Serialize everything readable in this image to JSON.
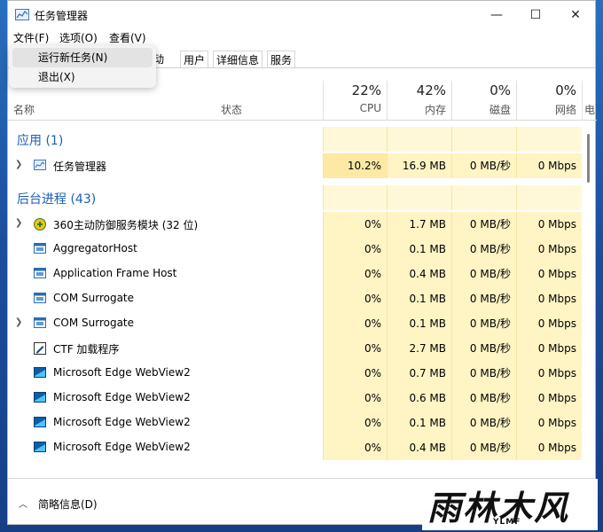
{
  "window": {
    "title": "任务管理器"
  },
  "controls": {
    "minimize": "—",
    "maximize": "☐",
    "close": "✕"
  },
  "menubar": {
    "file": "文件(F)",
    "options": "选项(O)",
    "view": "查看(V)"
  },
  "file_menu": {
    "run_new_task": "运行新任务(N)",
    "exit": "退出(X)"
  },
  "tabs": [
    "启动",
    "用户",
    "详细信息",
    "服务"
  ],
  "tab_partial": "动",
  "header": {
    "name": "名称",
    "status": "状态",
    "cpu_pct": "22%",
    "cpu": "CPU",
    "mem_pct": "42%",
    "mem": "内存",
    "disk_pct": "0%",
    "disk": "磁盘",
    "net_pct": "0%",
    "net": "网络",
    "extra": "电"
  },
  "groups": {
    "apps": "应用 (1)",
    "background": "后台进程 (43)"
  },
  "apps": [
    {
      "name": "任务管理器",
      "cpu": "10.2%",
      "mem": "16.9 MB",
      "disk": "0 MB/秒",
      "net": "0 Mbps"
    }
  ],
  "background": [
    {
      "name": "360主动防御服务模块 (32 位)",
      "cpu": "0%",
      "mem": "1.7 MB",
      "disk": "0 MB/秒",
      "net": "0 Mbps"
    },
    {
      "name": "AggregatorHost",
      "cpu": "0%",
      "mem": "0.1 MB",
      "disk": "0 MB/秒",
      "net": "0 Mbps"
    },
    {
      "name": "Application Frame Host",
      "cpu": "0%",
      "mem": "0.4 MB",
      "disk": "0 MB/秒",
      "net": "0 Mbps"
    },
    {
      "name": "COM Surrogate",
      "cpu": "0%",
      "mem": "0.1 MB",
      "disk": "0 MB/秒",
      "net": "0 Mbps"
    },
    {
      "name": "COM Surrogate",
      "cpu": "0%",
      "mem": "0.1 MB",
      "disk": "0 MB/秒",
      "net": "0 Mbps"
    },
    {
      "name": "CTF 加载程序",
      "cpu": "0%",
      "mem": "2.7 MB",
      "disk": "0 MB/秒",
      "net": "0 Mbps"
    },
    {
      "name": "Microsoft Edge WebView2",
      "cpu": "0%",
      "mem": "0.7 MB",
      "disk": "0 MB/秒",
      "net": "0 Mbps"
    },
    {
      "name": "Microsoft Edge WebView2",
      "cpu": "0%",
      "mem": "0.6 MB",
      "disk": "0 MB/秒",
      "net": "0 Mbps"
    },
    {
      "name": "Microsoft Edge WebView2",
      "cpu": "0%",
      "mem": "0.1 MB",
      "disk": "0 MB/秒",
      "net": "0 Mbps"
    },
    {
      "name": "Microsoft Edge WebView2",
      "cpu": "0%",
      "mem": "0.4 MB",
      "disk": "0 MB/秒",
      "net": "0 Mbps"
    }
  ],
  "footer": {
    "label": "简略信息(D)"
  },
  "watermark": {
    "text": "雨林木风",
    "sub": "YLMF"
  }
}
